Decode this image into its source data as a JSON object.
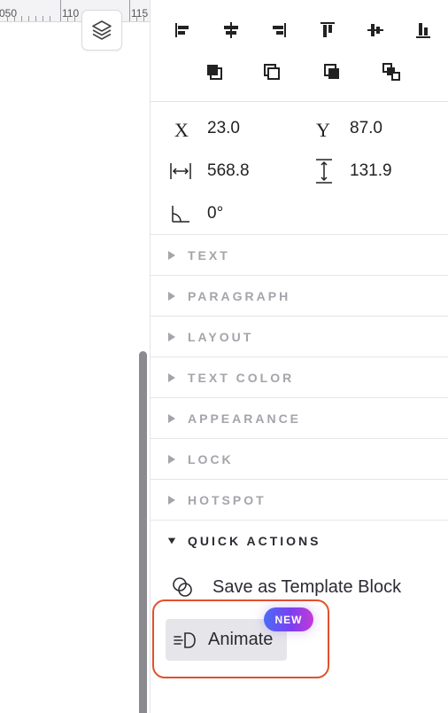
{
  "ruler": {
    "labels": [
      "050",
      "110",
      "115"
    ]
  },
  "transform": {
    "x_glyph": "X",
    "x_value": "23.0",
    "y_glyph": "Y",
    "y_value": "87.0",
    "width_value": "568.8",
    "height_value": "131.9",
    "rotation_value": "0°"
  },
  "sections": [
    {
      "label": "TEXT"
    },
    {
      "label": "PARAGRAPH"
    },
    {
      "label": "LAYOUT"
    },
    {
      "label": "TEXT COLOR"
    },
    {
      "label": "APPEARANCE"
    },
    {
      "label": "LOCK"
    },
    {
      "label": "HOTSPOT"
    },
    {
      "label": "QUICK ACTIONS"
    }
  ],
  "quick_actions": {
    "save_template_label": "Save as Template Block",
    "animate_label": "Animate",
    "new_badge": "NEW"
  },
  "colors": {
    "accent_highlight": "#e2502c",
    "badge_gradient_start": "#4a6cf7",
    "badge_gradient_end": "#c43bd6"
  }
}
